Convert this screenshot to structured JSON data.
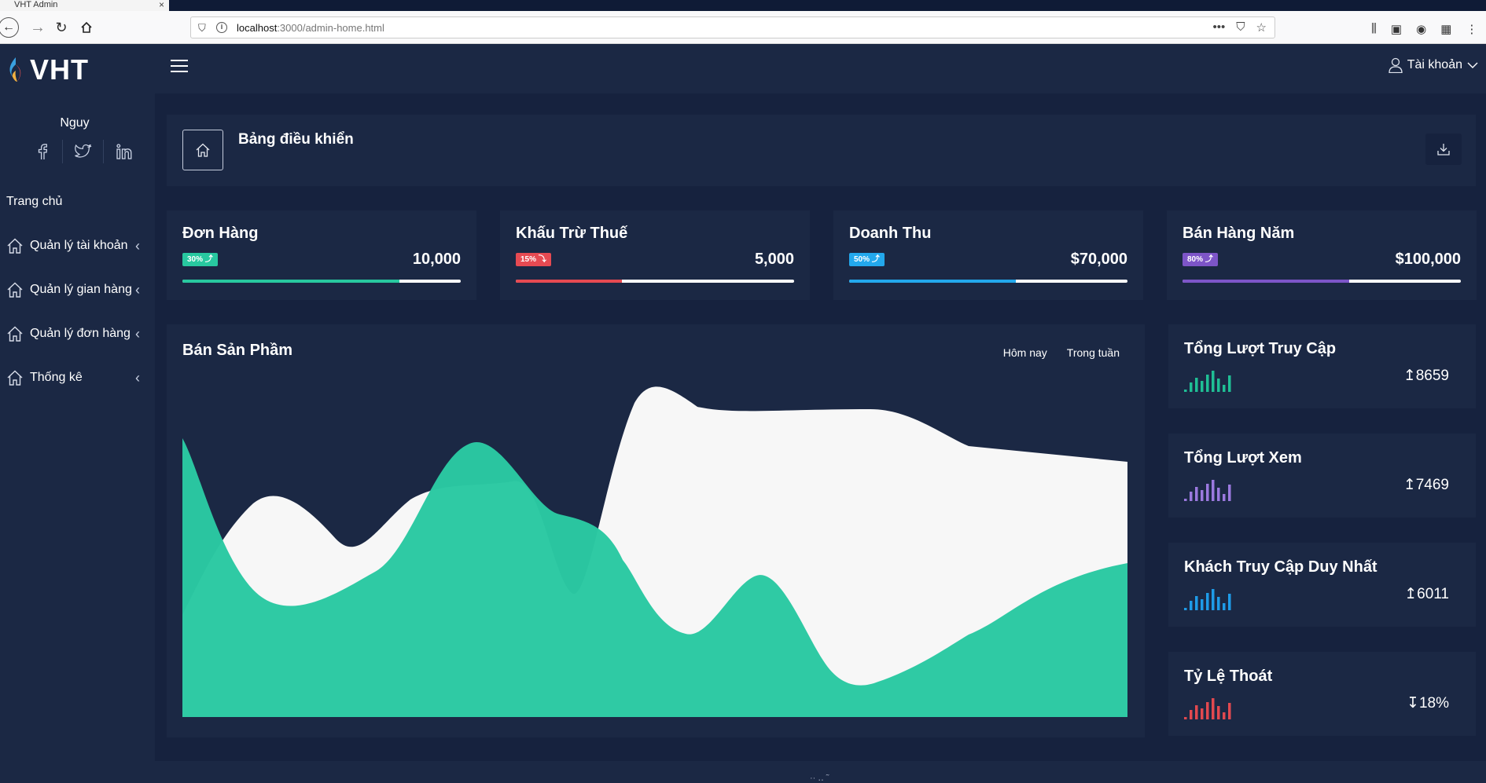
{
  "browser": {
    "tab_title": "VHT Admin",
    "tab_close": "×",
    "url_host": "localhost",
    "url_path": ":3000/admin-home.html"
  },
  "brand": {
    "name": "VHT"
  },
  "profile": {
    "name": "Nguy"
  },
  "sidebar": {
    "heading": "Trang chủ",
    "items": [
      {
        "label": "Quản lý tài khoản"
      },
      {
        "label": "Quản lý gian hàng"
      },
      {
        "label": "Quản lý đơn hàng"
      },
      {
        "label": "Thống kê"
      }
    ]
  },
  "header": {
    "account_label": "Tài khoản"
  },
  "page": {
    "title": "Bảng điều khiển"
  },
  "stats": [
    {
      "title": "Đơn Hàng",
      "badge": "30% ⤴",
      "value": "10,000",
      "color": "#28c8a0",
      "progress": 0.78
    },
    {
      "title": "Khấu Trừ Thuế",
      "badge": "15% ⤵",
      "value": "5,000",
      "color": "#e64a52",
      "progress": 0.38
    },
    {
      "title": "Doanh Thu",
      "badge": "50% ⤴",
      "value": "$70,000",
      "color": "#23a8ec",
      "progress": 0.6
    },
    {
      "title": "Bán Hàng Năm",
      "badge": "80% ⤴",
      "value": "$100,000",
      "color": "#7d55c8",
      "progress": 0.6
    }
  ],
  "sales_chart": {
    "title": "Bán Sản Phầm",
    "tabs": [
      "Hôm nay",
      "Trong tuần"
    ]
  },
  "metrics": [
    {
      "title": "Tổng Lượt Truy Cập",
      "value": "↥8659",
      "color": "#1fbf95"
    },
    {
      "title": "Tổng Lượt Xem",
      "value": "↥7469",
      "color": "#9b79df"
    },
    {
      "title": "Khách Truy Cập Duy Nhất",
      "value": "↥6011",
      "color": "#1e9be8"
    },
    {
      "title": "Tỷ Lệ Thoát",
      "value": "↧18%",
      "color": "#e2494f"
    }
  ],
  "colors": {
    "background": "#16223e",
    "panel": "#1b2844",
    "series_green": "#2bc9a2",
    "series_white": "#f7f7f7"
  },
  "icons": {
    "social": [
      "facebook-icon",
      "twitter-icon",
      "linkedin-icon"
    ],
    "menu": "home-icon",
    "download": "download-icon",
    "account": "user-icon"
  },
  "footer_hint": "·· ‥ ˜"
}
